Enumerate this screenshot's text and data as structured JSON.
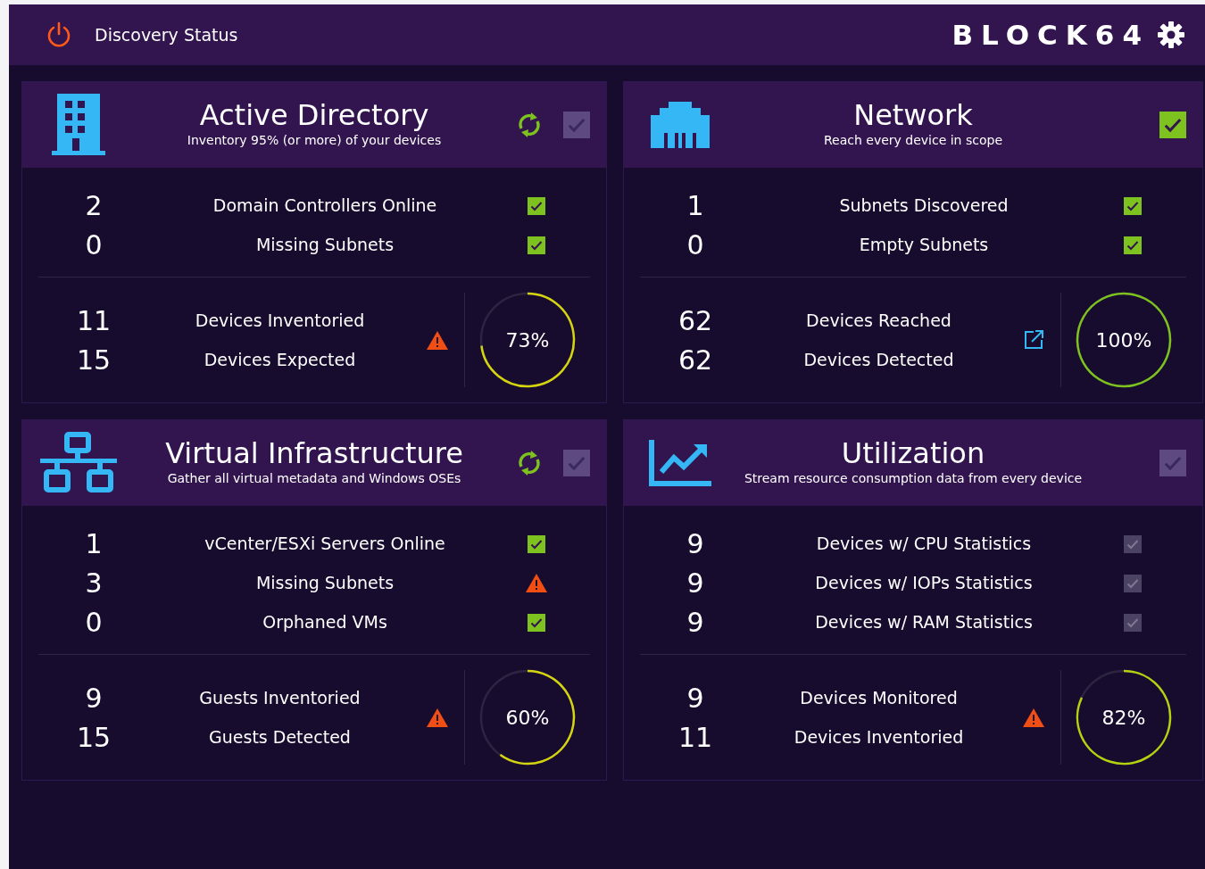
{
  "header": {
    "title": "Discovery Status",
    "brand": "BLOCK64"
  },
  "cards": [
    {
      "kind": "building",
      "title": "Active Directory",
      "subtitle": "Inventory 95% (or more) of your devices",
      "syncing": true,
      "complete": false,
      "checks": [
        {
          "value": "2",
          "label": "Domain Controllers Online",
          "kind": "ok"
        },
        {
          "value": "0",
          "label": "Missing Subnets",
          "kind": "ok"
        }
      ],
      "summary": {
        "rows": [
          {
            "value": "11",
            "label": "Devices Inventoried"
          },
          {
            "value": "15",
            "label": "Devices Expected"
          }
        ],
        "kind": "warn",
        "percent": "73%",
        "color": "#d4d40f"
      }
    },
    {
      "kind": "ethernet",
      "title": "Network",
      "subtitle": "Reach every device in scope",
      "syncing": false,
      "complete": true,
      "checks": [
        {
          "value": "1",
          "label": "Subnets Discovered",
          "kind": "ok"
        },
        {
          "value": "0",
          "label": "Empty Subnets",
          "kind": "ok"
        }
      ],
      "summary": {
        "rows": [
          {
            "value": "62",
            "label": "Devices Reached"
          },
          {
            "value": "62",
            "label": "Devices Detected"
          }
        ],
        "kind": "link",
        "percent": "100%",
        "color": "#7dc21e"
      }
    },
    {
      "kind": "sitemap",
      "title": "Virtual Infrastructure",
      "subtitle": "Gather all virtual metadata and Windows OSEs",
      "syncing": true,
      "complete": false,
      "checks": [
        {
          "value": "1",
          "label": "vCenter/ESXi Servers Online",
          "kind": "ok"
        },
        {
          "value": "3",
          "label": "Missing Subnets",
          "kind": "warn"
        },
        {
          "value": "0",
          "label": "Orphaned VMs",
          "kind": "ok"
        }
      ],
      "summary": {
        "rows": [
          {
            "value": "9",
            "label": "Guests Inventoried"
          },
          {
            "value": "15",
            "label": "Guests Detected"
          }
        ],
        "kind": "warn",
        "percent": "60%",
        "color": "#d4d40f"
      }
    },
    {
      "kind": "chart",
      "title": "Utilization",
      "subtitle": "Stream resource consumption data from every device",
      "syncing": false,
      "complete": false,
      "checks": [
        {
          "value": "9",
          "label": "Devices w/ CPU Statistics",
          "kind": "muted"
        },
        {
          "value": "9",
          "label": "Devices w/ IOPs Statistics",
          "kind": "muted"
        },
        {
          "value": "9",
          "label": "Devices w/ RAM Statistics",
          "kind": "muted"
        }
      ],
      "summary": {
        "rows": [
          {
            "value": "9",
            "label": "Devices Monitored"
          },
          {
            "value": "11",
            "label": "Devices Inventoried"
          }
        ],
        "kind": "warn",
        "percent": "82%",
        "color": "#b5d20f"
      }
    }
  ]
}
